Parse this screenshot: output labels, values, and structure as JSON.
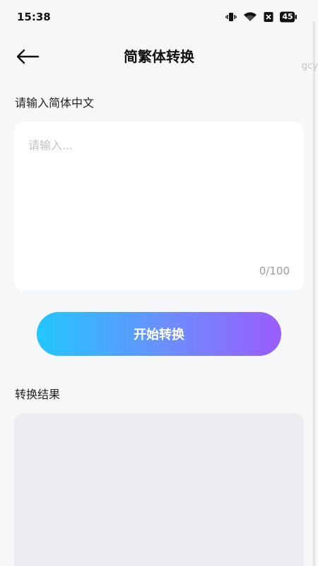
{
  "status_bar": {
    "time": "15:38",
    "battery_level": "45",
    "icons": [
      "vibrate-icon",
      "wifi-icon",
      "close-box-icon",
      "battery-icon"
    ]
  },
  "watermark": "gcy",
  "app_bar": {
    "back_icon": "arrow-left-icon",
    "title": "简繁体转换"
  },
  "input_section": {
    "label": "请输入简体中文",
    "placeholder": "请输入...",
    "value": "",
    "counter": "0/100"
  },
  "convert_button": {
    "label": "开始转换"
  },
  "result_section": {
    "label": "转换结果",
    "value": ""
  },
  "colors": {
    "background": "#f6f7f9",
    "button_gradient_start": "#22c7ff",
    "button_gradient_end": "#9a5cff",
    "result_box": "#ebecef"
  }
}
